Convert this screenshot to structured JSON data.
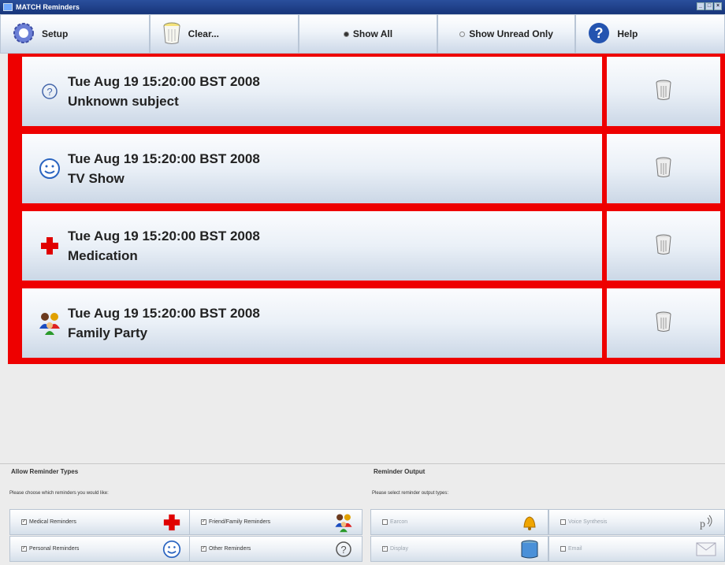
{
  "window": {
    "title": "MATCH Reminders"
  },
  "toolbar": {
    "setup_label": "Setup",
    "clear_label": "Clear...",
    "show_all_label": "Show All",
    "show_unread_label": "Show Unread Only",
    "help_label": "Help",
    "selected_filter": "show_all"
  },
  "reminders": [
    {
      "datetime": "Tue Aug 19 15:20:00 BST 2008",
      "subject": "Unknown subject",
      "icon": "question-icon"
    },
    {
      "datetime": "Tue Aug 19 15:20:00 BST 2008",
      "subject": "TV Show",
      "icon": "smiley-icon"
    },
    {
      "datetime": "Tue Aug 19 15:20:00 BST 2008",
      "subject": "Medication",
      "icon": "red-cross-icon"
    },
    {
      "datetime": "Tue Aug 19 15:20:00 BST 2008",
      "subject": "Family Party",
      "icon": "family-icon"
    }
  ],
  "allow_types": {
    "title": "Allow Reminder Types",
    "description": "Please choose which reminders you would like:",
    "options": [
      {
        "label": "Medical Reminders",
        "checked": true,
        "icon": "red-cross-icon"
      },
      {
        "label": "Friend/Family Reminders",
        "checked": true,
        "icon": "family-icon"
      },
      {
        "label": "Personal Reminders",
        "checked": true,
        "icon": "smiley-icon"
      },
      {
        "label": "Other Reminders",
        "checked": true,
        "icon": "question-icon"
      }
    ]
  },
  "output": {
    "title": "Reminder Output",
    "description": "Please select reminder output types:",
    "options": [
      {
        "label": "Earcon",
        "checked": false,
        "icon": "bell-icon"
      },
      {
        "label": "Voice Synthesis",
        "checked": false,
        "icon": "voice-icon"
      },
      {
        "label": "Display",
        "checked": true,
        "icon": "display-icon"
      },
      {
        "label": "Email",
        "checked": false,
        "icon": "envelope-icon"
      }
    ]
  },
  "colors": {
    "accent": "#ee0000",
    "button_top": "#ffffff",
    "button_bottom": "#cdd9e8"
  }
}
